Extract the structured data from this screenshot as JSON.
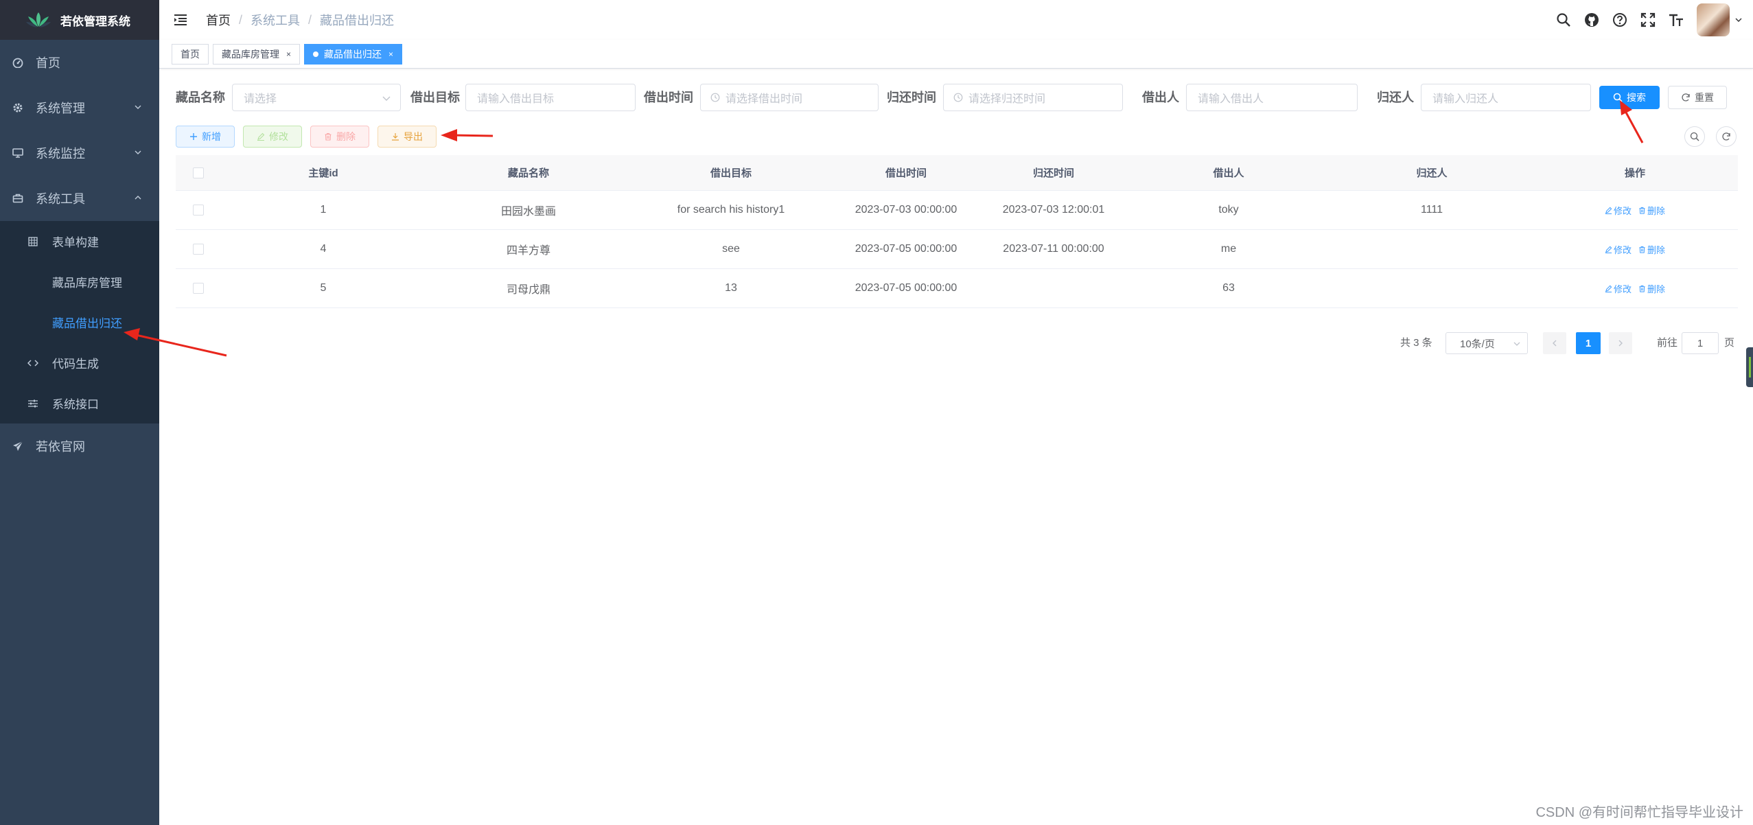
{
  "app": {
    "title": "若依管理系统"
  },
  "sidebar": {
    "items": [
      {
        "label": "首页"
      },
      {
        "label": "系统管理"
      },
      {
        "label": "系统监控"
      },
      {
        "label": "系统工具"
      },
      {
        "label": "若依官网"
      }
    ],
    "tools_children": {
      "form_builder": "表单构建",
      "storage_mgmt": "藏品库房管理",
      "borrow_return": "藏品借出归还",
      "code_gen": "代码生成",
      "sys_api": "系统接口"
    }
  },
  "breadcrumb": {
    "home": "首页",
    "tools": "系统工具",
    "current": "藏品借出归还",
    "separator": "/"
  },
  "tags": [
    {
      "label": "首页"
    },
    {
      "label": "藏品库房管理",
      "close": "×"
    },
    {
      "label": "藏品借出归还",
      "close": "×"
    }
  ],
  "search": {
    "name_label": "藏品名称",
    "name_placeholder": "请选择",
    "target_label": "借出目标",
    "target_placeholder": "请输入借出目标",
    "borrow_time_label": "借出时间",
    "borrow_time_placeholder": "请选择借出时间",
    "return_time_label": "归还时间",
    "return_time_placeholder": "请选择归还时间",
    "borrower_label": "借出人",
    "borrower_placeholder": "请输入借出人",
    "returner_label": "归还人",
    "returner_placeholder": "请输入归还人",
    "search_btn": "搜索",
    "reset_btn": "重置"
  },
  "toolbar": {
    "add": "新增",
    "edit": "修改",
    "delete": "删除",
    "export": "导出"
  },
  "table": {
    "headers": [
      "主键id",
      "藏品名称",
      "借出目标",
      "借出时间",
      "归还时间",
      "借出人",
      "归还人",
      "操作"
    ],
    "rows": [
      {
        "id": "1",
        "name": "田园水墨画",
        "target": "for search his history1",
        "borrow_time": "2023-07-03 00:00:00",
        "return_time": "2023-07-03 12:00:01",
        "borrower": "toky",
        "returner": "1111"
      },
      {
        "id": "4",
        "name": "四羊方尊",
        "target": "see",
        "borrow_time": "2023-07-05 00:00:00",
        "return_time": "2023-07-11 00:00:00",
        "borrower": "me",
        "returner": ""
      },
      {
        "id": "5",
        "name": "司母戊鼎",
        "target": "13",
        "borrow_time": "2023-07-05 00:00:00",
        "return_time": "",
        "borrower": "63",
        "returner": ""
      }
    ],
    "op_edit": "修改",
    "op_delete": "删除"
  },
  "pagination": {
    "total": "共 3 条",
    "page_size": "10条/页",
    "current_page": "1",
    "goto_prefix": "前往",
    "goto_value": "1",
    "goto_suffix": "页"
  },
  "watermark": "CSDN @有时间帮忙指导毕业设计",
  "colors": {
    "sidebar_bg": "#304156",
    "sidebar_sub_bg": "#1f2d3d",
    "accent": "#409eff",
    "primary_button": "#1890ff",
    "annotation_arrow": "#e8261c"
  }
}
